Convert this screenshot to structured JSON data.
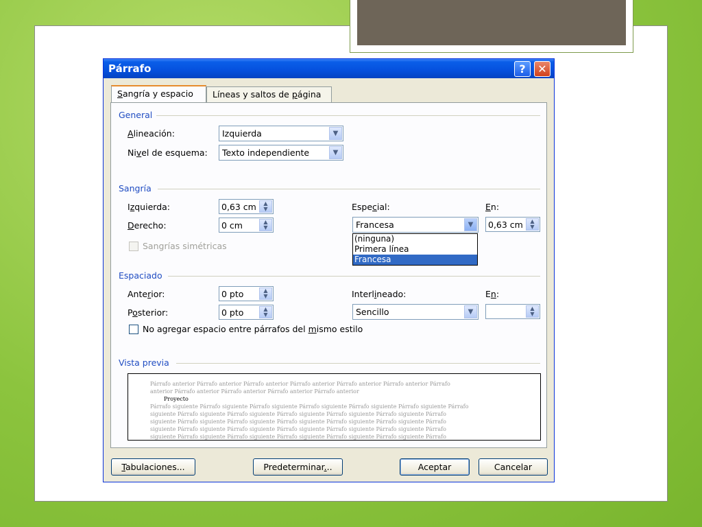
{
  "dialog": {
    "title": "Párrafo",
    "help_label": "?",
    "close_label": "✕"
  },
  "tabs": [
    {
      "label_pre": "",
      "label_key": "S",
      "label_post": "angría y espacio"
    },
    {
      "label_pre": "Líneas y saltos de ",
      "label_key": "p",
      "label_post": "ágina"
    }
  ],
  "general": {
    "section": "General",
    "alignment_label_key": "A",
    "alignment_label_post": "lineación:",
    "alignment_value": "Izquierda",
    "outline_label_pre": "Ni",
    "outline_label_key": "v",
    "outline_label_post": "el de esquema:",
    "outline_value": "Texto independiente"
  },
  "indent": {
    "section": "Sangría",
    "left_label_pre": "I",
    "left_label_key": "z",
    "left_label_post": "quierda:",
    "left_value": "0,63 cm",
    "right_label_key": "D",
    "right_label_post": "erecho:",
    "right_value": "0 cm",
    "mirror_label": "Sangrías simétricas",
    "special_label_pre": "Espe",
    "special_label_key": "c",
    "special_label_post": "ial:",
    "special_value": "Francesa",
    "by_label_key": "E",
    "by_label_post": "n:",
    "by_value": "0,63 cm",
    "special_options": [
      "(ninguna)",
      "Primera línea",
      "Francesa"
    ]
  },
  "spacing": {
    "section": "Espaciado",
    "before_label_pre": "Ante",
    "before_label_key": "r",
    "before_label_post": "ior:",
    "before_value": "0 pto",
    "after_label_pre": "P",
    "after_label_key": "o",
    "after_label_post": "sterior:",
    "after_value": "0 pto",
    "line_label_pre": "Interl",
    "line_label_key": "i",
    "line_label_post": "neado:",
    "line_value": "Sencillo",
    "at_label_pre": "E",
    "at_label_key": "n",
    "at_label_post": ":",
    "at_value": "",
    "no_space_pre": "No agregar espacio entre párrafos del ",
    "no_space_key": "m",
    "no_space_post": "ismo estilo"
  },
  "preview": {
    "section": "Vista previa",
    "prev_lines": [
      "Párrafo anterior Párrafo anterior Párrafo anterior Párrafo anterior Párrafo anterior Párrafo anterior Párrafo",
      "anterior Párrafo anterior Párrafo anterior Párrafo anterior Párrafo anterior"
    ],
    "current": "Proyecto",
    "next_lines": [
      "Párrafo siguiente Párrafo siguiente Párrafo siguiente Párrafo siguiente Párrafo siguiente Párrafo siguiente Párrafo",
      "siguiente Párrafo siguiente Párrafo siguiente Párrafo siguiente Párrafo siguiente Párrafo siguiente Párrafo",
      "siguiente Párrafo siguiente Párrafo siguiente Párrafo siguiente Párrafo siguiente Párrafo siguiente Párrafo",
      "siguiente Párrafo siguiente Párrafo siguiente Párrafo siguiente Párrafo siguiente Párrafo siguiente Párrafo",
      "siguiente Párrafo siguiente Párrafo siguiente Párrafo siguiente Párrafo siguiente Párrafo siguiente Párrafo"
    ]
  },
  "buttons": {
    "tabs_key": "T",
    "tabs_post": "abulaciones...",
    "default_pre": "Predeterminar",
    "default_key": ".",
    "default_post": "..",
    "ok": "Aceptar",
    "cancel": "Cancelar"
  },
  "colors": {
    "titlebar": "#0550dd",
    "section_title": "#1f4cc2",
    "selection": "#316ac5",
    "slide_background": "#8cc43e",
    "top_block": "#6e6558"
  }
}
